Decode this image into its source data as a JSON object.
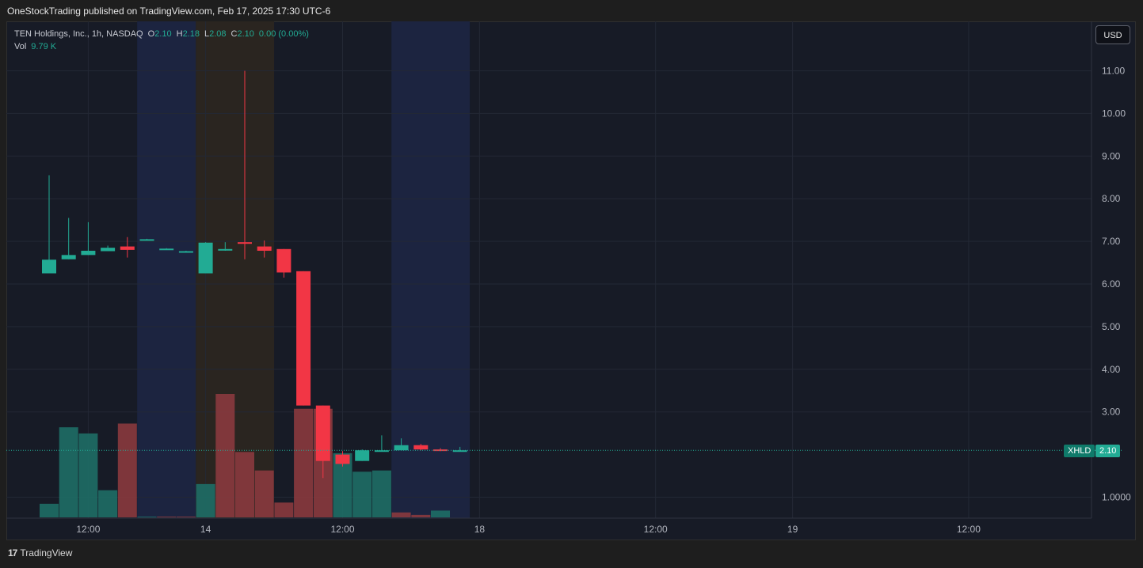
{
  "header": {
    "publisher_line": "OneStockTrading published on TradingView.com, Feb 17, 2025 17:30 UTC-6"
  },
  "legend": {
    "symbol": "TEN Holdings, Inc., 1h, NASDAQ",
    "o_label": "O",
    "o_value": "2.10",
    "h_label": "H",
    "h_value": "2.18",
    "l_label": "L",
    "l_value": "2.08",
    "c_label": "C",
    "c_value": "2.10",
    "change": "0.00 (0.00%)",
    "vol_label": "Vol",
    "vol_value": "9.79 K"
  },
  "currency_button": "USD",
  "price_tag": {
    "ticker": "XHLD",
    "price": "2.10"
  },
  "footer": {
    "logo_glyph": "17",
    "brand": "TradingView"
  },
  "colors": {
    "up": "#22ab94",
    "down": "#f23645",
    "background": "#171b26",
    "session_blue": "#1c2440",
    "session_brown": "#2a2520"
  },
  "chart_data": {
    "type": "candlestick",
    "price_ticks": [
      "11.00",
      "10.00",
      "9.00",
      "8.00",
      "7.00",
      "6.00",
      "5.00",
      "4.00",
      "3.00",
      "1.0000"
    ],
    "price_tick_values": [
      11,
      10,
      9,
      8,
      7,
      6,
      5,
      4,
      3,
      1
    ],
    "ylim": [
      0.5,
      12
    ],
    "time_labels": [
      "12:00",
      "14",
      "12:00",
      "18",
      "12:00",
      "19",
      "12:00"
    ],
    "time_label_index": [
      2,
      8,
      15,
      22,
      31,
      38,
      47
    ],
    "session_bands": [
      {
        "start_index": 5,
        "end_index": 7,
        "kind": "blue"
      },
      {
        "start_index": 8,
        "end_index": 11,
        "kind": "brown"
      },
      {
        "start_index": 18,
        "end_index": 21,
        "kind": "blue"
      }
    ],
    "candles": [
      {
        "i": 0,
        "o": 6.25,
        "h": 8.55,
        "l": 6.25,
        "c": 6.57
      },
      {
        "i": 1,
        "o": 6.58,
        "h": 7.55,
        "l": 6.58,
        "c": 6.68
      },
      {
        "i": 2,
        "o": 6.68,
        "h": 7.45,
        "l": 6.68,
        "c": 6.78
      },
      {
        "i": 3,
        "o": 6.77,
        "h": 6.9,
        "l": 6.77,
        "c": 6.85
      },
      {
        "i": 4,
        "o": 6.88,
        "h": 7.1,
        "l": 6.62,
        "c": 6.8
      },
      {
        "i": 5,
        "o": 7.03,
        "h": 7.06,
        "l": 7.03,
        "c": 7.05
      },
      {
        "i": 6,
        "o": 6.82,
        "h": 6.84,
        "l": 6.82,
        "c": 6.83
      },
      {
        "i": 7,
        "o": 6.76,
        "h": 6.78,
        "l": 6.76,
        "c": 6.77
      },
      {
        "i": 8,
        "o": 6.25,
        "h": 6.98,
        "l": 6.25,
        "c": 6.97
      },
      {
        "i": 9,
        "o": 6.8,
        "h": 6.98,
        "l": 6.78,
        "c": 6.82
      },
      {
        "i": 10,
        "o": 6.98,
        "h": 11.0,
        "l": 6.58,
        "c": 6.95
      },
      {
        "i": 11,
        "o": 6.88,
        "h": 7.02,
        "l": 6.62,
        "c": 6.78
      },
      {
        "i": 12,
        "o": 6.82,
        "h": 6.82,
        "l": 6.15,
        "c": 6.27
      },
      {
        "i": 13,
        "o": 6.3,
        "h": 6.3,
        "l": 3.15,
        "c": 3.15
      },
      {
        "i": 14,
        "o": 3.15,
        "h": 3.15,
        "l": 1.45,
        "c": 1.85
      },
      {
        "i": 15,
        "o": 2.0,
        "h": 2.08,
        "l": 1.72,
        "c": 1.78
      },
      {
        "i": 16,
        "o": 1.85,
        "h": 2.12,
        "l": 1.85,
        "c": 2.1
      },
      {
        "i": 17,
        "o": 2.08,
        "h": 2.45,
        "l": 2.08,
        "c": 2.1
      },
      {
        "i": 18,
        "o": 2.1,
        "h": 2.38,
        "l": 2.1,
        "c": 2.22
      },
      {
        "i": 19,
        "o": 2.22,
        "h": 2.25,
        "l": 2.1,
        "c": 2.12
      },
      {
        "i": 20,
        "o": 2.12,
        "h": 2.15,
        "l": 2.08,
        "c": 2.1
      },
      {
        "i": 21,
        "o": 2.1,
        "h": 2.18,
        "l": 2.08,
        "c": 2.1
      }
    ],
    "volume": [
      {
        "i": 0,
        "v": 0.11,
        "dir": "up"
      },
      {
        "i": 1,
        "v": 0.73,
        "dir": "up"
      },
      {
        "i": 2,
        "v": 0.68,
        "dir": "up"
      },
      {
        "i": 3,
        "v": 0.22,
        "dir": "up"
      },
      {
        "i": 4,
        "v": 0.76,
        "dir": "down"
      },
      {
        "i": 5,
        "v": 0.005,
        "dir": "up"
      },
      {
        "i": 6,
        "v": 0.005,
        "dir": "down"
      },
      {
        "i": 7,
        "v": 0.005,
        "dir": "down"
      },
      {
        "i": 8,
        "v": 0.27,
        "dir": "up"
      },
      {
        "i": 9,
        "v": 1.0,
        "dir": "down"
      },
      {
        "i": 10,
        "v": 0.53,
        "dir": "down"
      },
      {
        "i": 11,
        "v": 0.38,
        "dir": "down"
      },
      {
        "i": 12,
        "v": 0.12,
        "dir": "down"
      },
      {
        "i": 13,
        "v": 0.88,
        "dir": "down"
      },
      {
        "i": 14,
        "v": 0.88,
        "dir": "down"
      },
      {
        "i": 15,
        "v": 0.52,
        "dir": "up"
      },
      {
        "i": 16,
        "v": 0.37,
        "dir": "up"
      },
      {
        "i": 17,
        "v": 0.38,
        "dir": "up"
      },
      {
        "i": 18,
        "v": 0.04,
        "dir": "down"
      },
      {
        "i": 19,
        "v": 0.02,
        "dir": "down"
      },
      {
        "i": 20,
        "v": 0.055,
        "dir": "up"
      }
    ],
    "last_price": 2.1,
    "grid": true
  }
}
